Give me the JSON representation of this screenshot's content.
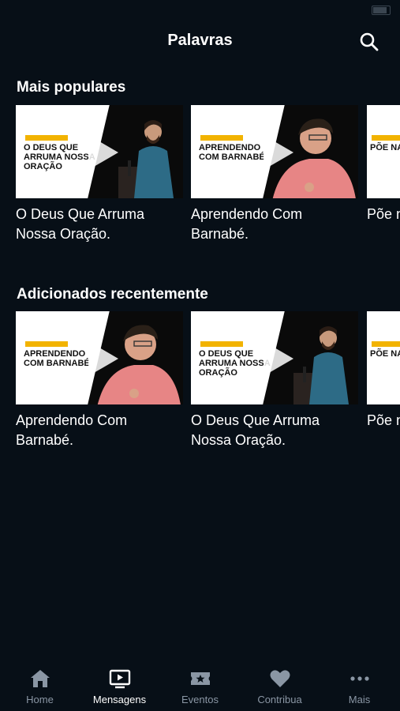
{
  "header": {
    "title": "Palavras"
  },
  "sections": [
    {
      "title": "Mais populares",
      "cards": [
        {
          "title": "O Deus Que Arruma Nossa Oração.",
          "thumb_text": "O Deus que arruma nossa oração",
          "speaker": "young"
        },
        {
          "title": "Aprendendo Com Barnabé.",
          "thumb_text": "Aprendendo com Barnabé",
          "speaker": "older"
        },
        {
          "title": "Põe n",
          "thumb_text": "Põe na minha",
          "speaker": "none"
        }
      ]
    },
    {
      "title": "Adicionados recentemente",
      "cards": [
        {
          "title": "Aprendendo Com Barnabé.",
          "thumb_text": "Aprendendo com Barnabé",
          "speaker": "older"
        },
        {
          "title": "O Deus Que Arruma Nossa Oração.",
          "thumb_text": "O Deus que arruma nossa oração",
          "speaker": "young"
        },
        {
          "title": "Põe n",
          "thumb_text": "Põe na minha",
          "speaker": "none"
        }
      ]
    }
  ],
  "tabs": [
    {
      "label": "Home",
      "icon": "home-icon"
    },
    {
      "label": "Mensagens",
      "icon": "tv-play-icon",
      "active": true
    },
    {
      "label": "Eventos",
      "icon": "ticket-star-icon"
    },
    {
      "label": "Contribua",
      "icon": "heart-icon"
    },
    {
      "label": "Mais",
      "icon": "more-dots-icon"
    }
  ],
  "colors": {
    "background": "#070f17",
    "tag_yellow": "#f2b300",
    "inactive_tab": "#8a96a4"
  }
}
